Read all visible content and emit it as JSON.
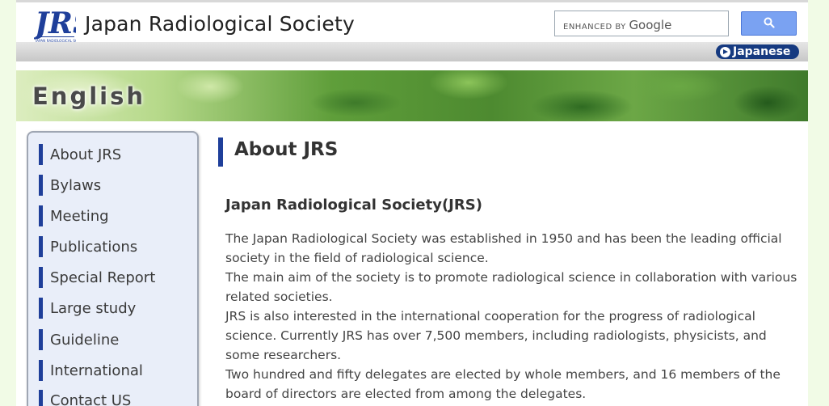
{
  "header": {
    "title": "Japan Radiological Society",
    "logo_text": "JRS",
    "logo_subtext": "JAPAN RADIOLOGICAL SOCIETY",
    "search_brand_prefix": "ENHANCED BY",
    "search_brand_name": "Google",
    "search_icon": "search-icon",
    "language_link": "Japanese"
  },
  "banner": {
    "title": "English"
  },
  "sidebar": {
    "items": [
      {
        "label": "About JRS"
      },
      {
        "label": "Bylaws"
      },
      {
        "label": "Meeting"
      },
      {
        "label": "Publications"
      },
      {
        "label": "Special Report"
      },
      {
        "label": "Large study"
      },
      {
        "label": "Guideline"
      },
      {
        "label": "International"
      },
      {
        "label": "Contact US"
      }
    ]
  },
  "main": {
    "heading": "About JRS",
    "subheading": "Japan Radiological Society(JRS)",
    "paragraphs": [
      "The Japan Radiological Society was established in 1950 and has been the leading official society in the field of radiological science.",
      "The main aim of the society is to promote radiological science in collaboration with various related societies.",
      "JRS is also interested in the international cooperation for the progress of radiological science. Currently JRS has over 7,500 members, including radiologists, physicists, and some researchers.",
      "Two hundred and fifty delegates are elected by whole members, and 16 members of the board of directors are elected from among the delegates."
    ]
  },
  "colors": {
    "accent": "#1f3f9a",
    "search_button": "#7aa2f2",
    "page_background": "#f1fbe6"
  }
}
